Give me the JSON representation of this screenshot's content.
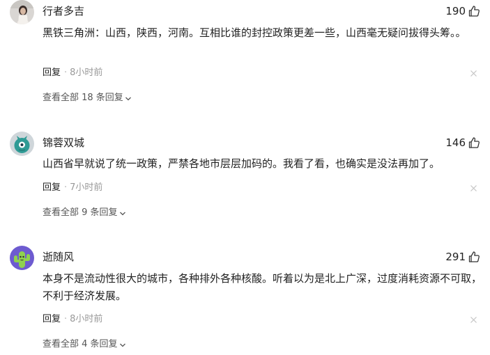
{
  "comments": [
    {
      "username": "行者多吉",
      "likes": "190",
      "content": "黑铁三角洲：山西，陕西，河南。互相比谁的封控政策更差一些，山西毫无疑问拔得头筹。。",
      "reply_label": "回复",
      "separator": "·",
      "time": "8小时前",
      "view_replies": "查看全部 18 条回复",
      "avatar_icon": "photo-avatar"
    },
    {
      "username": "锦蓉双城",
      "likes": "146",
      "content": "山西省早就说了统一政策，严禁各地市层层加码的。我看了看，也确实是没法再加了。",
      "reply_label": "回复",
      "separator": "·",
      "time": "7小时前",
      "view_replies": "查看全部 9 条回复",
      "avatar_icon": "teal-creature-avatar"
    },
    {
      "username": "逝随风",
      "likes": "291",
      "content": "本身不是流动性很大的城市，各种排外各种核酸。听着以为是北上广深，过度消耗资源不可取，不利于经济发展。",
      "reply_label": "回复",
      "separator": "·",
      "time": "8小时前",
      "view_replies": "查看全部 4 条回复",
      "avatar_icon": "cactus-avatar"
    }
  ],
  "colors": {
    "text": "#222222",
    "muted": "#999999",
    "icon": "#555555"
  }
}
